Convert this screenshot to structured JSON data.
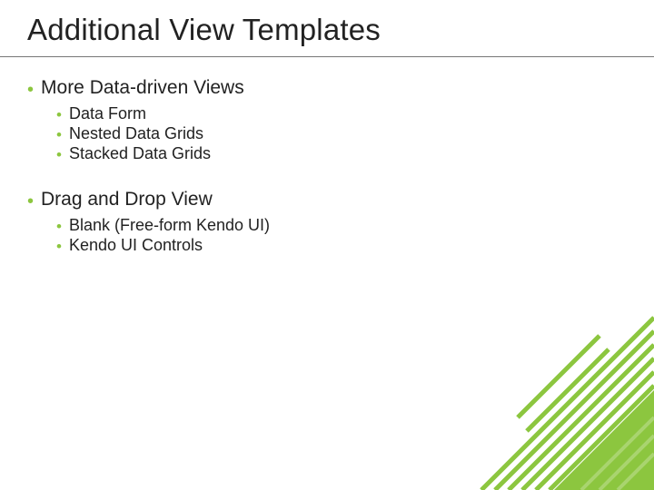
{
  "title": "Additional View Templates",
  "colors": {
    "accent": "#8cc63f",
    "text": "#222222",
    "rule": "#777777"
  },
  "sections": [
    {
      "heading": "More Data-driven Views",
      "items": [
        "Data Form",
        "Nested Data Grids",
        "Stacked Data Grids"
      ]
    },
    {
      "heading": "Drag and Drop View",
      "items": [
        "Blank (Free-form Kendo UI)",
        " Kendo UI Controls"
      ]
    }
  ]
}
